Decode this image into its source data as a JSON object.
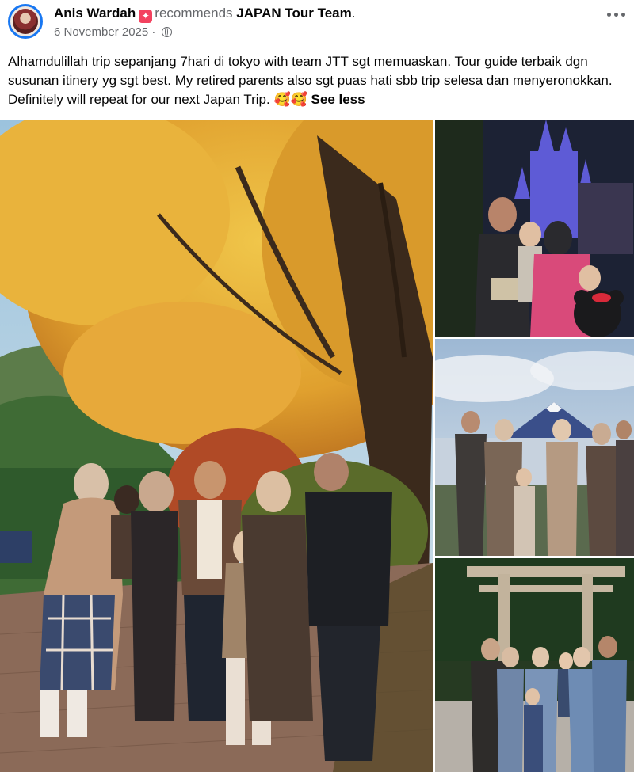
{
  "post": {
    "author": "Anis Wardah",
    "recommends_text": "recommends",
    "page_name": "JAPAN Tour Team",
    "date": "6 November 2025",
    "separator": "·",
    "privacy_icon": "globe-icon",
    "more_icon": "more-options-icon",
    "text": "Alhamdulillah trip sepanjang 7hari di tokyo with team JTT sgt memuaskan. Tour guide terbaik dgn susunan itinery yg sgt best. My retired parents also sgt puas hati sbb trip selesa dan menyeronokkan. Definitely will repeat for our next Japan Trip.",
    "emoji": "🥰🥰",
    "see_less": "See less"
  },
  "photos": [
    {
      "description_icon": "photo-family-autumn-tree"
    },
    {
      "description_icon": "photo-family-castle-night"
    },
    {
      "description_icon": "photo-family-mount-fuji"
    },
    {
      "description_icon": "photo-family-torii-gate"
    }
  ],
  "colors": {
    "recommend_badge": "#f3425f",
    "avatar_ring": "#1877f2",
    "secondary_text": "#65676b"
  }
}
